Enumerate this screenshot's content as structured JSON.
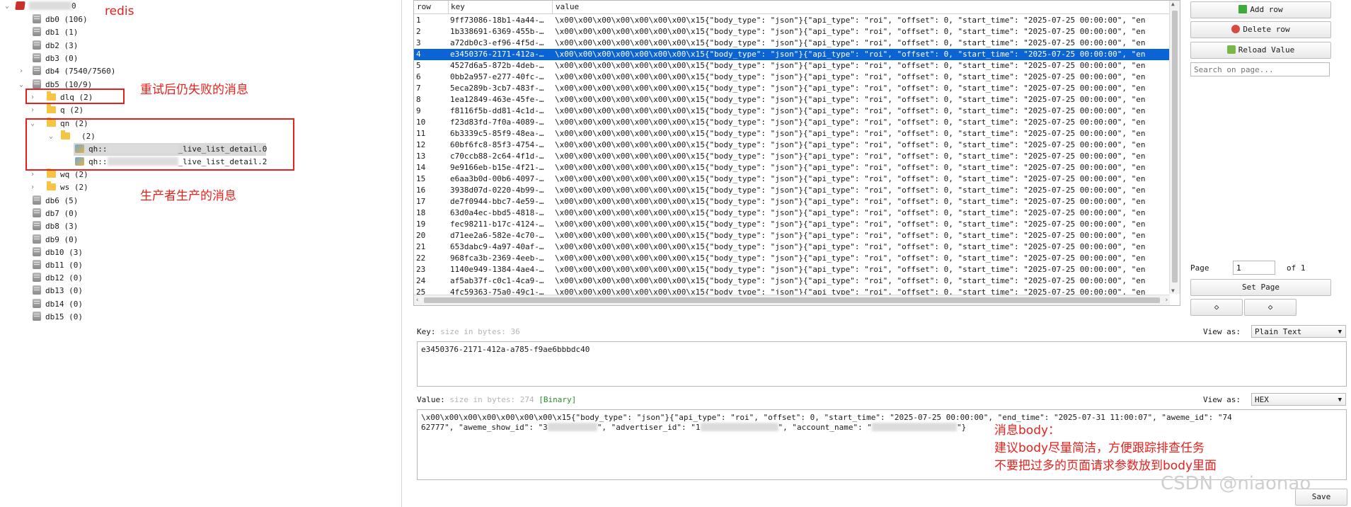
{
  "tree": {
    "root_suffix": "0",
    "annotation_redis": "redis",
    "dbs_top": [
      {
        "label": "db0 (106)"
      },
      {
        "label": "db1 (1)"
      },
      {
        "label": "db2 (3)"
      },
      {
        "label": "db3 (0)"
      },
      {
        "label": "db4 (7540/7560)"
      },
      {
        "label": "db5 (10/9)"
      }
    ],
    "db5_children": {
      "dlq": "dlq (2)",
      "q": "q (2)",
      "qn": "qn (2)",
      "qn_sub": "(2)",
      "key1_prefix": "qh::",
      "key1_suffix": "_live_list_detail.0",
      "key2_prefix": "qh::",
      "key2_suffix": "_live_list_detail.2",
      "wq": "wq (2)",
      "ws": "ws (2)"
    },
    "dbs_bottom": [
      {
        "label": "db6 (5)"
      },
      {
        "label": "db7 (0)"
      },
      {
        "label": "db8 (3)"
      },
      {
        "label": "db9 (0)"
      },
      {
        "label": "db10 (3)"
      },
      {
        "label": "db11 (0)"
      },
      {
        "label": "db12 (0)"
      },
      {
        "label": "db13 (0)"
      },
      {
        "label": "db14 (0)"
      },
      {
        "label": "db15 (0)"
      }
    ],
    "annotation_failed": "重试后仍失败的消息",
    "annotation_producer": "生产者生产的消息"
  },
  "table": {
    "columns": [
      "row",
      "key",
      "value"
    ],
    "selected_row": 4,
    "value_text": "\\x00\\x00\\x00\\x00\\x00\\x00\\x00\\x15{\"body_type\": \"json\"}{\"api_type\": \"roi\", \"offset\": 0, \"start_time\": \"2025-07-25 00:00:00\", \"en",
    "rows": [
      {
        "n": "1",
        "key": "9ff73086-18b1-4a44-…"
      },
      {
        "n": "2",
        "key": "1b338691-6369-455b-…"
      },
      {
        "n": "3",
        "key": "a72db0c3-ef96-4f5d-…"
      },
      {
        "n": "4",
        "key": "e3450376-2171-412a-…"
      },
      {
        "n": "5",
        "key": "4527d6a5-872b-4deb-…"
      },
      {
        "n": "6",
        "key": "0bb2a957-e277-40fc-…"
      },
      {
        "n": "7",
        "key": "5eca289b-3cb7-483f-…"
      },
      {
        "n": "8",
        "key": "1ea12849-463e-45fe-…"
      },
      {
        "n": "9",
        "key": "f8116f5b-dd81-4c1d-…"
      },
      {
        "n": "10",
        "key": "f23d83fd-7f0a-4089-…"
      },
      {
        "n": "11",
        "key": "6b3339c5-85f9-48ea-…"
      },
      {
        "n": "12",
        "key": "60bf6fc8-85f3-4754-…"
      },
      {
        "n": "13",
        "key": "c70ccb88-2c64-4f1d-…"
      },
      {
        "n": "14",
        "key": "9e9166eb-b15e-4f21-…"
      },
      {
        "n": "15",
        "key": "e6aa3b0d-00b6-4097-…"
      },
      {
        "n": "16",
        "key": "3938d07d-0220-4b99-…"
      },
      {
        "n": "17",
        "key": "de7f0944-bbc7-4e59-…"
      },
      {
        "n": "18",
        "key": "63d0a4ec-bbd5-4818-…"
      },
      {
        "n": "19",
        "key": "fec98211-b17c-4124-…"
      },
      {
        "n": "20",
        "key": "d71ee2a6-582e-4c70-…"
      },
      {
        "n": "21",
        "key": "653dabc9-4a97-40af-…"
      },
      {
        "n": "22",
        "key": "968fca3b-2369-4eeb-…"
      },
      {
        "n": "23",
        "key": "1140e949-1384-4ae4-…"
      },
      {
        "n": "24",
        "key": "af5ab37f-c0c1-4ca9-…"
      },
      {
        "n": "25",
        "key": "4fc59363-75a0-49c1-…"
      }
    ]
  },
  "right": {
    "add_row": "Add row",
    "delete_row": "Delete row",
    "reload_value": "Reload Value",
    "search_placeholder": "Search on page...",
    "page_label": "Page",
    "page_value": "1",
    "page_of": "of 1",
    "set_page": "Set Page",
    "prev": "◇",
    "next": "◇"
  },
  "key_editor": {
    "label": "Key:",
    "size": "size in bytes: 36",
    "view_as_label": "View as:",
    "view_as_value": "Plain Text",
    "value": "e3450376-2171-412a-a785-f9ae6bbbdc40"
  },
  "value_editor": {
    "label": "Value:",
    "size": "size in bytes: 274",
    "binary": "[Binary]",
    "view_as_label": "View as:",
    "view_as_value": "HEX",
    "line1": "\\x00\\x00\\x00\\x00\\x00\\x00\\x00\\x15{\"body_type\": \"json\"}{\"api_type\": \"roi\", \"offset\": 0, \"start_time\": \"2025-07-25 00:00:00\", \"end_time\": \"2025-07-31 11:00:07\", \"aweme_id\": \"74",
    "line2a": "62777\", \"aweme_show_id\": \"3",
    "line2b": "\", \"advertiser_id\": \"1",
    "line2c": "\", \"account_name\": \"",
    "line2d": "\"}",
    "save": "Save"
  },
  "annotation_body": {
    "line1": "消息body：",
    "line2": "建议body尽量简洁，方便跟踪排查任务",
    "line3": "不要把过多的页面请求参数放到body里面"
  },
  "watermark": "CSDN @niaonao",
  "colors": {
    "selection": "#0a64d6",
    "annotation": "#e8201c",
    "folder": "#f6c443"
  }
}
